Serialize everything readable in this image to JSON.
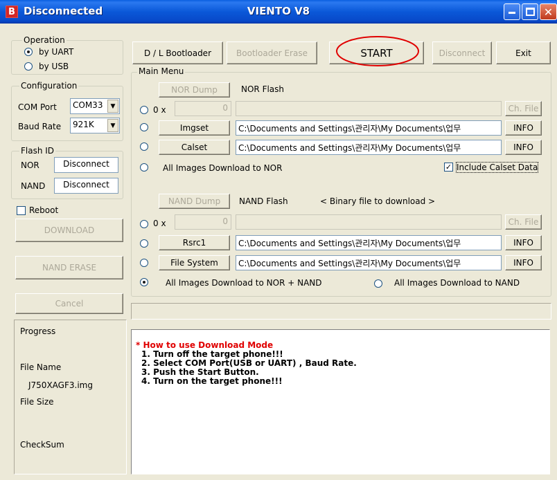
{
  "window": {
    "icon_letter": "B",
    "status": "Disconnected",
    "title": "VIENTO V8"
  },
  "operation": {
    "legend": "Operation",
    "by_uart": "by UART",
    "by_usb": "by USB",
    "selected": "by UART"
  },
  "configuration": {
    "legend": "Configuration",
    "com_port_label": "COM Port",
    "com_port_value": "COM33",
    "baud_rate_label": "Baud Rate",
    "baud_rate_value": "921K"
  },
  "flash_id": {
    "legend": "Flash ID",
    "nor_label": "NOR",
    "nor_value": "Disconnect",
    "nand_label": "NAND",
    "nand_value": "Disconnect"
  },
  "left_actions": {
    "reboot": "Reboot",
    "download": "DOWNLOAD",
    "nand_erase": "NAND ERASE",
    "cancel": "Cancel"
  },
  "info_panel": {
    "progress": "Progress",
    "file_name_label": "File Name",
    "file_name_value": "J750XAGF3.img",
    "file_size_label": "File Size",
    "checksum_label": "CheckSum"
  },
  "toolbar": {
    "dl_bootloader": "D / L Bootloader",
    "bootloader_erase": "Bootloader Erase",
    "start": "START",
    "disconnect": "Disconnect",
    "exit": "Exit"
  },
  "main_menu": {
    "legend": "Main Menu",
    "nor_dump": "NOR Dump",
    "nor_flash": "NOR Flash",
    "nor_hex_prefix": "0 x",
    "nor_hex_value": "0",
    "ch_file": "Ch. File",
    "imgset_button": "Imgset",
    "imgset_path": "C:\\Documents and Settings\\관리자\\My Documents\\업무",
    "calset_button": "Calset",
    "calset_path": "C:\\Documents and Settings\\관리자\\My Documents\\업무",
    "info": "INFO",
    "all_nor": "All Images Download to NOR",
    "include_calset": "Include Calset Data",
    "nand_dump": "NAND Dump",
    "nand_flash": "NAND Flash",
    "binary_hint": "< Binary file to download >",
    "nand_hex_prefix": "0 x",
    "nand_hex_value": "0",
    "rsrc1_button": "Rsrc1",
    "rsrc1_path": "C:\\Documents and Settings\\관리자\\My Documents\\업무",
    "filesystem_button": "File System",
    "filesystem_path": "C:\\Documents and Settings\\관리자\\My Documents\\업무",
    "all_nor_nand": "All Images Download to NOR + NAND",
    "all_nand": "All Images Download to NAND"
  },
  "instructions": {
    "heading": "* How to use Download Mode",
    "steps": [
      "1. Turn off the target phone!!!",
      "2. Select COM Port(USB or UART) , Baud Rate.",
      "3. Push the Start Button.",
      "4. Turn on the target phone!!!"
    ]
  },
  "colors": {
    "title_blue": "#0a58d8",
    "window_bg": "#ece9d8",
    "instruction_red": "#e00000",
    "highlight_circle": "#e00000"
  }
}
